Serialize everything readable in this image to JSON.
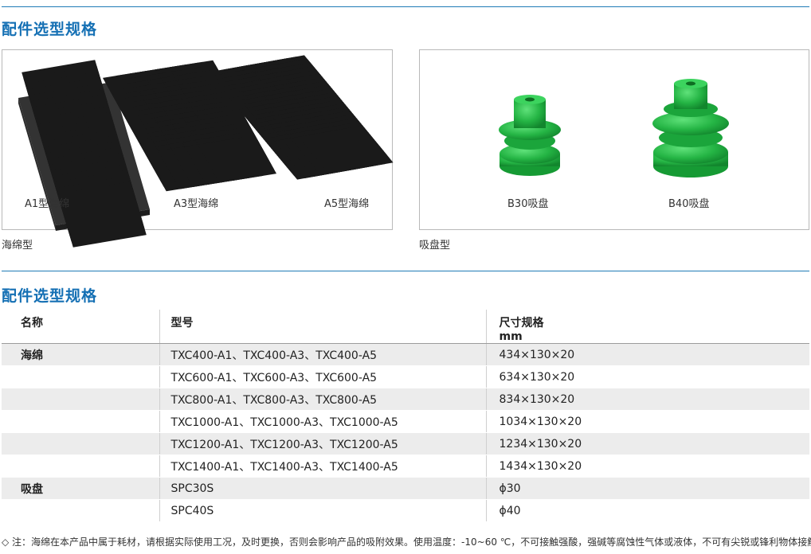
{
  "section1": {
    "title": "配件选型规格"
  },
  "sponge_panel": {
    "items": [
      {
        "label": "A1型海绵"
      },
      {
        "label": "A3型海绵"
      },
      {
        "label": "A5型海绵"
      }
    ],
    "caption": "海绵型"
  },
  "cup_panel": {
    "items": [
      {
        "label": "B30吸盘"
      },
      {
        "label": "B40吸盘"
      }
    ],
    "caption": "吸盘型"
  },
  "section2": {
    "title": "配件选型规格"
  },
  "table": {
    "headers": {
      "name": "名称",
      "model": "型号",
      "size": "尺寸规格",
      "size_unit": "mm"
    },
    "rows": [
      {
        "name": "海绵",
        "model": "TXC400-A1、TXC400-A3、TXC400-A5",
        "size": "434×130×20"
      },
      {
        "name": "",
        "model": "TXC600-A1、TXC600-A3、TXC600-A5",
        "size": "634×130×20"
      },
      {
        "name": "",
        "model": "TXC800-A1、TXC800-A3、TXC800-A5",
        "size": "834×130×20"
      },
      {
        "name": "",
        "model": "TXC1000-A1、TXC1000-A3、TXC1000-A5",
        "size": "1034×130×20"
      },
      {
        "name": "",
        "model": "TXC1200-A1、TXC1200-A3、TXC1200-A5",
        "size": "1234×130×20"
      },
      {
        "name": "",
        "model": "TXC1400-A1、TXC1400-A3、TXC1400-A5",
        "size": "1434×130×20"
      },
      {
        "name": "吸盘",
        "model": "SPC30S",
        "size": "ϕ30"
      },
      {
        "name": "",
        "model": "SPC40S",
        "size": "ϕ40"
      }
    ]
  },
  "note": "◇ 注：海绵在本产品中属于耗材，请根据实际使用工况，及时更换，否则会影响产品的吸附效果。使用温度：-10~60 ℃，不可接触强酸，强碱等腐蚀性气体或液体，不可有尖锐或锋利物体接触。",
  "colors": {
    "accent": "#1570b4",
    "rule": "#1f7bb6",
    "sponge": "#3d3d3d",
    "cup": "#2db84a"
  },
  "icons": [
    "sponge-a1-image",
    "sponge-a3-image",
    "sponge-a5-image",
    "suction-cup-b30-image",
    "suction-cup-b40-image"
  ]
}
